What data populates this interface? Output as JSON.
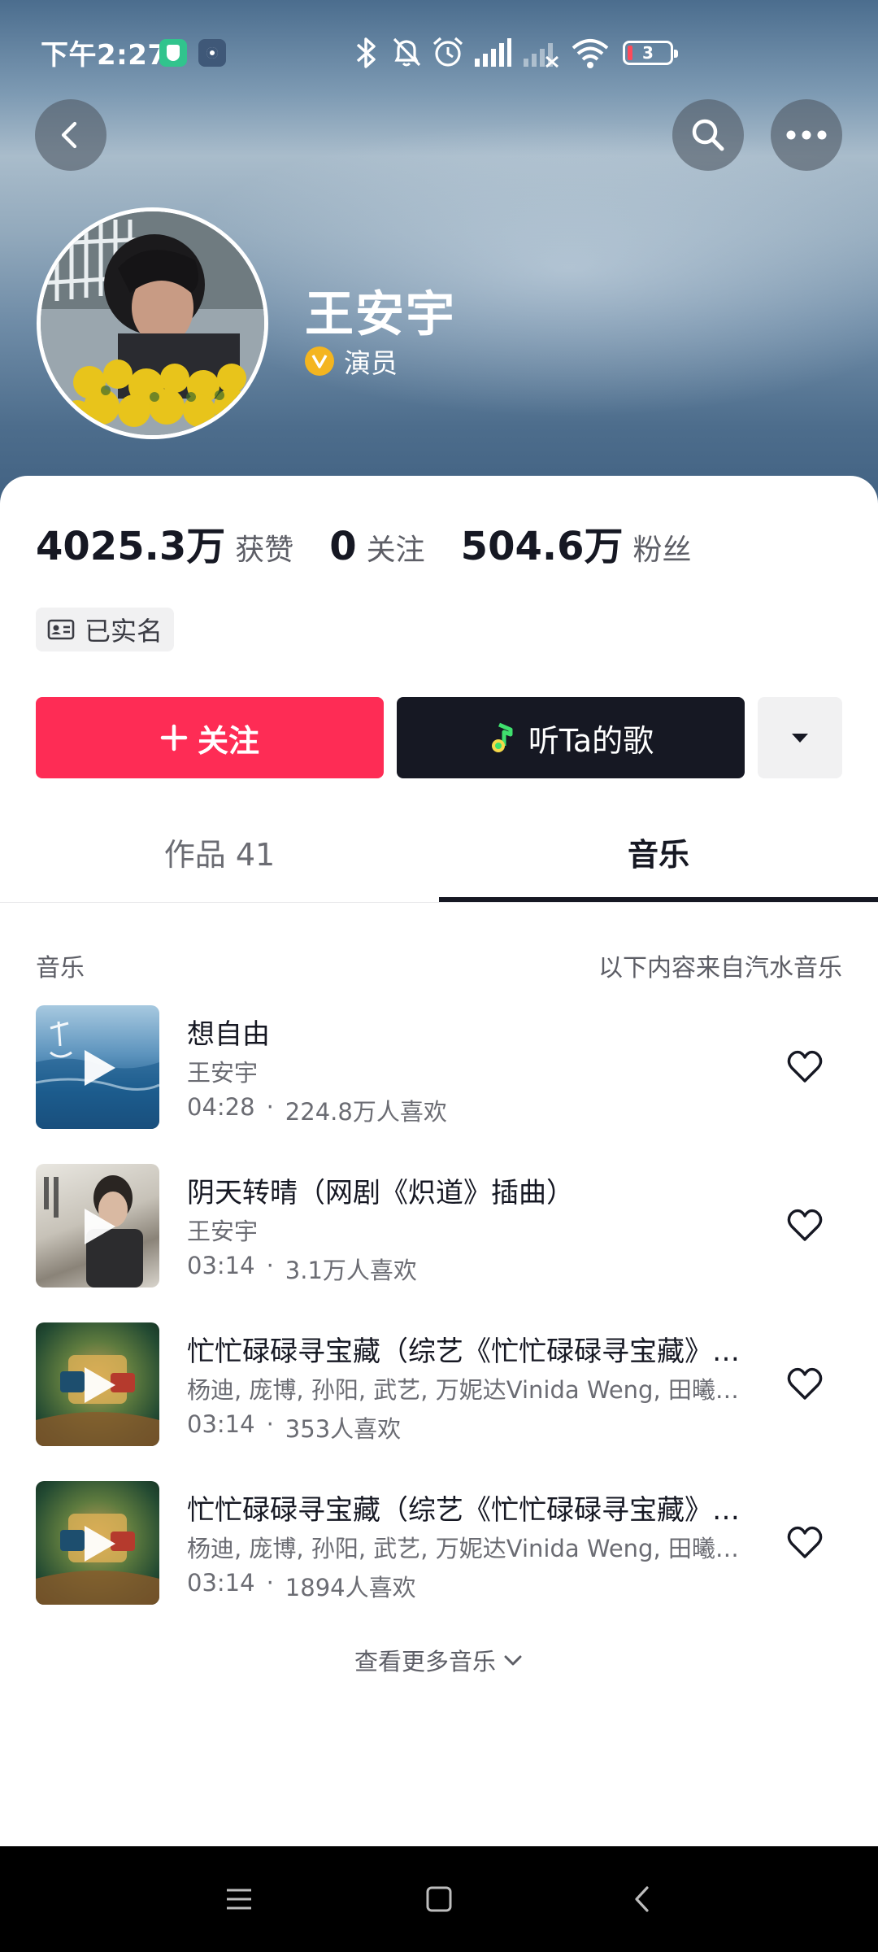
{
  "status_bar": {
    "time": "下午2:27",
    "battery_level": "3",
    "icons": [
      "app-shield-icon",
      "app-settings-icon",
      "bluetooth-icon",
      "mute-icon",
      "alarm-icon",
      "signal-icon",
      "signal-off-icon",
      "wifi-icon",
      "battery-icon"
    ]
  },
  "profile": {
    "name": "王安宇",
    "verified_label": "演员",
    "verified_icon": "v-badge-icon",
    "stats": [
      {
        "value": "4025.3万",
        "label": "获赞"
      },
      {
        "value": "0",
        "label": "关注"
      },
      {
        "value": "504.6万",
        "label": "粉丝"
      }
    ],
    "realname_label": "已实名"
  },
  "actions": {
    "follow_label": "关注",
    "listen_label": "听Ta的歌"
  },
  "tabs": [
    {
      "label": "作品 41",
      "active": false
    },
    {
      "label": "音乐",
      "active": true
    }
  ],
  "music": {
    "section_title": "音乐",
    "source_note": "以下内容来自汽水音乐",
    "songs": [
      {
        "title": "想自由",
        "artist": "王安宇",
        "duration": "04:28",
        "likes": "224.8万人喜欢"
      },
      {
        "title": "阴天转晴（网剧《炽道》插曲）",
        "artist": "王安宇",
        "duration": "03:14",
        "likes": "3.1万人喜欢"
      },
      {
        "title": "忙忙碌碌寻宝藏（综艺《忙忙碌碌寻宝藏》主题曲）",
        "artist": "杨迪, 庞博, 孙阳, 武艺, 万妮达Vinida Weng, 田曦薇, 王安宇",
        "duration": "03:14",
        "likes": "353人喜欢"
      },
      {
        "title": "忙忙碌碌寻宝藏（综艺《忙忙碌碌寻宝藏》主题曲）",
        "artist": "杨迪, 庞博, 孙阳, 武艺, 万妮达Vinida Weng, 田曦薇, 王安宇",
        "duration": "03:14",
        "likes": "1894人喜欢"
      }
    ],
    "see_more_label": "查看更多音乐"
  },
  "colors": {
    "follow": "#fe2c55",
    "listen": "#161823",
    "verified": "#f4b51f"
  }
}
